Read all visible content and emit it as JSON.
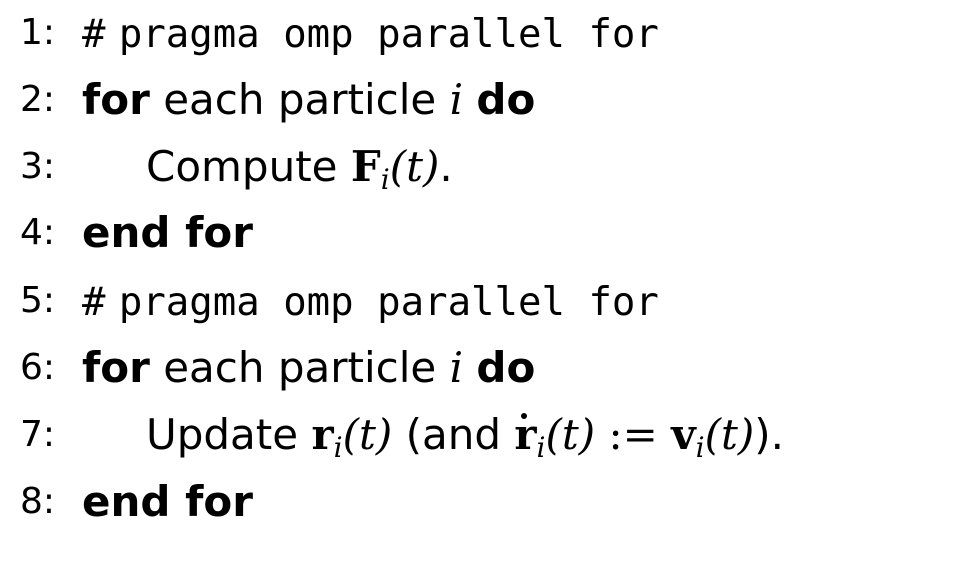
{
  "algorithm": {
    "lines": [
      {
        "number": "1:",
        "hash": "#",
        "directive": "pragma omp parallel for"
      },
      {
        "number": "2:",
        "for_kw": "for",
        "text": "each particle",
        "var": "i",
        "do_kw": "do"
      },
      {
        "number": "3:",
        "text": "Compute",
        "F": "F",
        "sub": "i",
        "arg": "(t)",
        "end": "."
      },
      {
        "number": "4:",
        "end_for": "end for"
      },
      {
        "number": "5:",
        "hash": "#",
        "directive": "pragma omp parallel for"
      },
      {
        "number": "6:",
        "for_kw": "for",
        "text": "each particle",
        "var": "i",
        "do_kw": "do"
      },
      {
        "number": "7:",
        "text": "Update",
        "r": "r",
        "sub": "i",
        "arg": "(t)",
        "paren_open": "(and",
        "assign": ":=",
        "v": "v",
        "close": ")."
      },
      {
        "number": "8:",
        "end_for": "end for"
      }
    ]
  }
}
